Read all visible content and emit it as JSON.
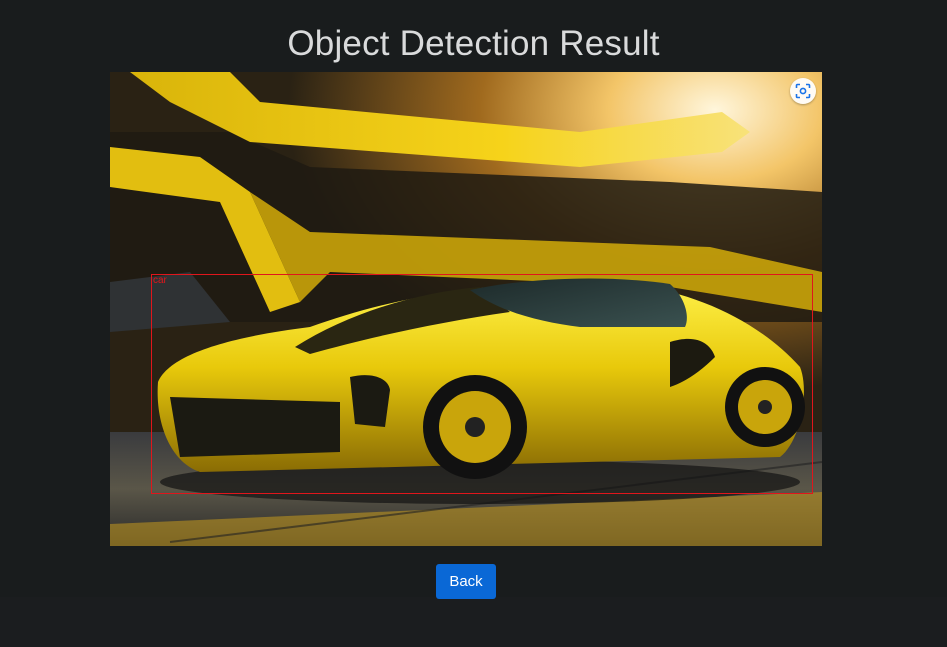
{
  "page": {
    "title": "Object Detection Result"
  },
  "result_image": {
    "subject": "yellow sports car",
    "lens_icon": "visual-search-icon"
  },
  "detections": [
    {
      "label": "car",
      "color": "#e0161c"
    }
  ],
  "actions": {
    "back_label": "Back",
    "back_color": "#0a68d6"
  }
}
